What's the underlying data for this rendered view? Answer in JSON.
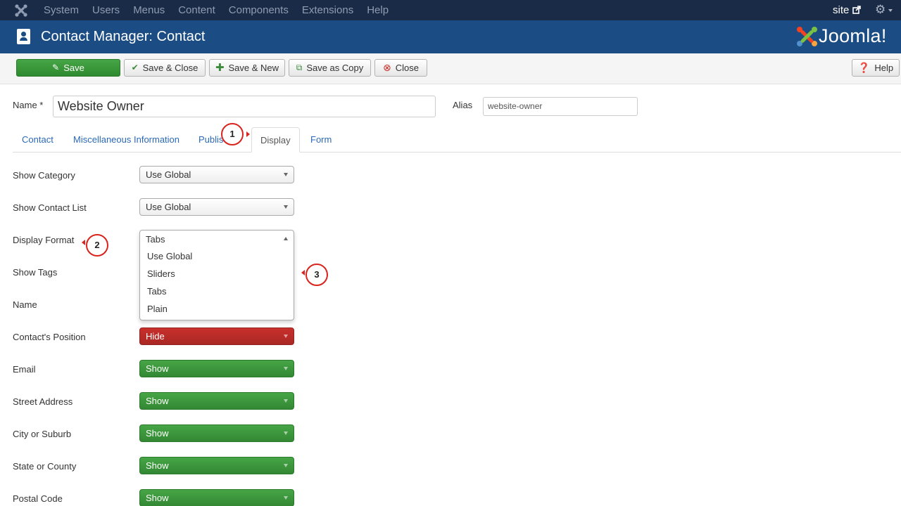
{
  "topnav": {
    "items": [
      "System",
      "Users",
      "Menus",
      "Content",
      "Components",
      "Extensions",
      "Help"
    ],
    "site_label": "site",
    "icons": [
      "joomla-logo-icon",
      "external-link-icon",
      "gear-icon"
    ]
  },
  "header": {
    "title": "Contact Manager: Contact",
    "logo_text": "Joomla!"
  },
  "toolbar": {
    "save": "Save",
    "save_close": "Save & Close",
    "save_new": "Save & New",
    "save_copy": "Save as Copy",
    "close": "Close",
    "help": "Help"
  },
  "form": {
    "name_label": "Name *",
    "name_value": "Website Owner",
    "alias_label": "Alias",
    "alias_value": "website-owner"
  },
  "tabs": [
    "Contact",
    "Miscellaneous Information",
    "Publis",
    "Display",
    "Form"
  ],
  "active_tab": "Display",
  "fields": [
    {
      "label": "Show Category",
      "value": "Use Global",
      "style": "default"
    },
    {
      "label": "Show Contact List",
      "value": "Use Global",
      "style": "default"
    },
    {
      "label": "Display Format",
      "value": "Tabs",
      "style": "open"
    },
    {
      "label": "Show Tags",
      "value": "",
      "style": "hidden"
    },
    {
      "label": "Name",
      "value": "",
      "style": "hidden"
    },
    {
      "label": "Contact's Position",
      "value": "Hide",
      "style": "red"
    },
    {
      "label": "Email",
      "value": "Show",
      "style": "green"
    },
    {
      "label": "Street Address",
      "value": "Show",
      "style": "green"
    },
    {
      "label": "City or Suburb",
      "value": "Show",
      "style": "green"
    },
    {
      "label": "State or County",
      "value": "Show",
      "style": "green"
    },
    {
      "label": "Postal Code",
      "value": "Show",
      "style": "green"
    }
  ],
  "dropdown": {
    "selected": "Tabs",
    "options": [
      "Use Global",
      "Sliders",
      "Tabs",
      "Plain"
    ]
  },
  "callouts": [
    "1",
    "2",
    "3"
  ],
  "colors": {
    "topnav": "#1a2b48",
    "header": "#1b4c84",
    "save_green": "#46a546",
    "hide_red": "#c9302c",
    "link_blue": "#2a69b8",
    "callout_red": "#d9231c"
  }
}
